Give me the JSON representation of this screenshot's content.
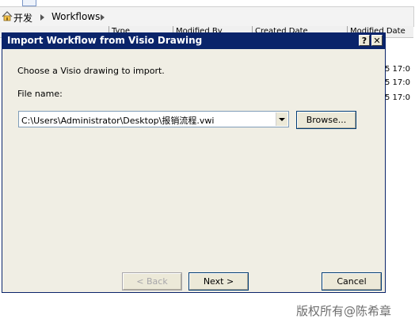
{
  "background": {
    "breadcrumb": [
      "开发",
      "Workflows"
    ],
    "column_headers": [
      "Type",
      "Modified By",
      "Created Date",
      "Modified Date"
    ],
    "row_fragments": [
      "5 17:0",
      "5 17:0",
      "5 17:0"
    ]
  },
  "dialog": {
    "title": "Import Workflow from Visio Drawing",
    "help_glyph": "?",
    "close_glyph": "✕",
    "prompt": "Choose a Visio drawing to import.",
    "file_label": "File name:",
    "file_value": "C:\\Users\\Administrator\\Desktop\\报销流程.vwi",
    "browse_label": "Browse...",
    "back_label": "< Back",
    "next_label": "Next >",
    "cancel_label": "Cancel"
  },
  "watermark": "版权所有@陈希章",
  "colors": {
    "titlebar": "#0a246a",
    "dialog_face": "#ece9d8"
  },
  "icons": {
    "breadcrumb_home": "house-icon",
    "breadcrumb_separator": "chevron-right-icon",
    "combo_dropdown": "chevron-down-icon"
  }
}
